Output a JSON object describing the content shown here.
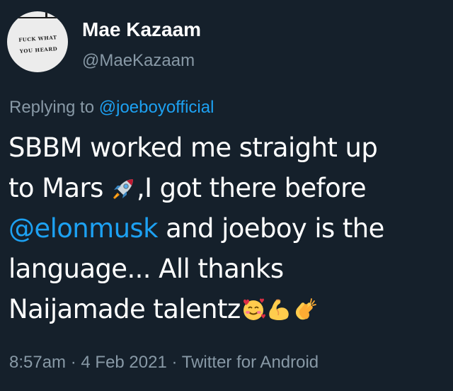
{
  "author": {
    "display_name": "Mae Kazaam",
    "handle": "@MaeKazaam",
    "avatar_text_line1": "FUCK WHAT",
    "avatar_text_line2": "YOU HEARD"
  },
  "reply": {
    "prefix": "Replying to ",
    "mention": "@joeboyofficial"
  },
  "tweet": {
    "line1": "SBBM worked me straight up",
    "line2_a": "to Mars ",
    "line2_b": ",I got there before",
    "line3_mention": "@elonmusk",
    "line3_rest": " and joeboy is the",
    "line4": "language... All thanks",
    "line5": "Naijamade talentz",
    "emojis": [
      "rocket-emoji",
      "smiling-face-with-hearts-emoji",
      "flexed-biceps-emoji",
      "clapping-hands-emoji"
    ]
  },
  "meta": {
    "time": "8:57am",
    "separator": " · ",
    "date": "4 Feb 2021",
    "source": "Twitter for Android"
  },
  "colors": {
    "background": "#15202b",
    "primary_text": "#ffffff",
    "secondary_text": "#8899a6",
    "link": "#1da1f2"
  }
}
